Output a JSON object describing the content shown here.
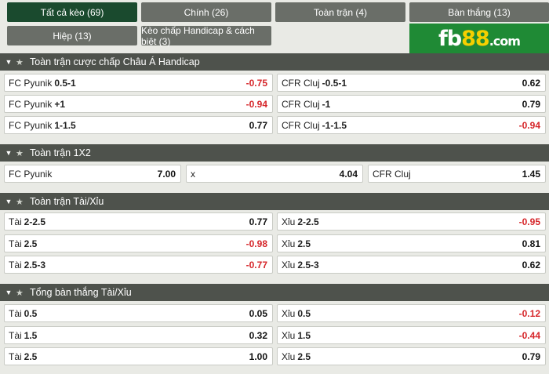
{
  "tabs": [
    {
      "label": "Tất cả kèo (69)",
      "active": true
    },
    {
      "label": "Chính (26)",
      "active": false
    },
    {
      "label": "Toàn trận (4)",
      "active": false
    },
    {
      "label": "Bàn thắng (13)",
      "active": false
    },
    {
      "label": "Hiệp (13)",
      "active": false
    },
    {
      "label": "Kèo chấp Handicap & cách biệt (3)",
      "active": false
    }
  ],
  "logo": {
    "main": "fb",
    "accent": "88",
    "domain": ".com"
  },
  "colors": {
    "active_tab": "#1a4a2e",
    "tab": "#6a6e68",
    "header": "#4e524c",
    "negative": "#d6262a",
    "logo_bg": "#1f8a35"
  },
  "sections": [
    {
      "title": "Toàn trận cược chấp Châu Á Handicap",
      "rows": [
        [
          {
            "team": "FC Pyunik",
            "line": "0.5-1",
            "odd": "-0.75"
          },
          {
            "team": "CFR Cluj",
            "line": "-0.5-1",
            "odd": "0.62"
          }
        ],
        [
          {
            "team": "FC Pyunik",
            "line": "+1",
            "odd": "-0.94"
          },
          {
            "team": "CFR Cluj",
            "line": "-1",
            "odd": "0.79"
          }
        ],
        [
          {
            "team": "FC Pyunik",
            "line": "1-1.5",
            "odd": "0.77"
          },
          {
            "team": "CFR Cluj",
            "line": "-1-1.5",
            "odd": "-0.94"
          }
        ]
      ]
    },
    {
      "title": "Toàn trận 1X2",
      "rows": [
        [
          {
            "team": "FC Pyunik",
            "line": "",
            "odd": "7.00"
          },
          {
            "team": "x",
            "line": "",
            "odd": "4.04"
          },
          {
            "team": "CFR Cluj",
            "line": "",
            "odd": "1.45"
          }
        ]
      ]
    },
    {
      "title": "Toàn trận Tài/Xỉu",
      "rows": [
        [
          {
            "team": "Tài",
            "line": "2-2.5",
            "odd": "0.77"
          },
          {
            "team": "Xỉu",
            "line": "2-2.5",
            "odd": "-0.95"
          }
        ],
        [
          {
            "team": "Tài",
            "line": "2.5",
            "odd": "-0.98"
          },
          {
            "team": "Xỉu",
            "line": "2.5",
            "odd": "0.81"
          }
        ],
        [
          {
            "team": "Tài",
            "line": "2.5-3",
            "odd": "-0.77"
          },
          {
            "team": "Xỉu",
            "line": "2.5-3",
            "odd": "0.62"
          }
        ]
      ]
    },
    {
      "title": "Tổng bàn thắng Tài/Xỉu",
      "rows": [
        [
          {
            "team": "Tài",
            "line": "0.5",
            "odd": "0.05"
          },
          {
            "team": "Xỉu",
            "line": "0.5",
            "odd": "-0.12"
          }
        ],
        [
          {
            "team": "Tài",
            "line": "1.5",
            "odd": "0.32"
          },
          {
            "team": "Xỉu",
            "line": "1.5",
            "odd": "-0.44"
          }
        ],
        [
          {
            "team": "Tài",
            "line": "2.5",
            "odd": "1.00"
          },
          {
            "team": "Xỉu",
            "line": "2.5",
            "odd": "0.79"
          }
        ]
      ]
    }
  ]
}
